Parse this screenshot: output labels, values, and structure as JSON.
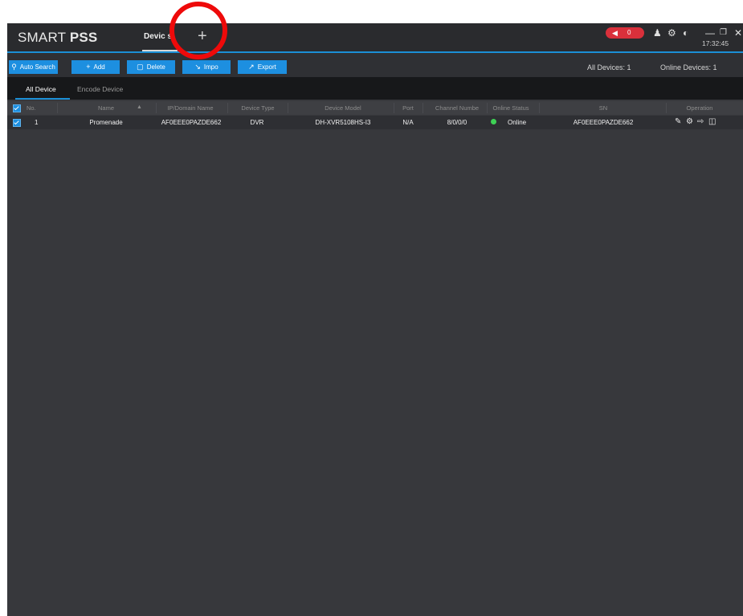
{
  "app": {
    "brand_regular": "SMART ",
    "brand_bold": "PSS",
    "clock": "17:32:45"
  },
  "tabs": {
    "devices_label": "Devic s",
    "add_glyph": "+"
  },
  "alarm": {
    "count": "0"
  },
  "toolbar": {
    "auto_search": "Auto Search",
    "add": "Add",
    "delete": "Delete",
    "import": "Impo",
    "export": "Export",
    "all_devices": "All Devices:  1",
    "online_devices": "Online Devices:  1"
  },
  "subtabs": {
    "all_device": "All Device",
    "encode_device": "Encode Device"
  },
  "table": {
    "headers": {
      "no": "No.",
      "name": "Name",
      "sort_arrow": "▲",
      "ip": "IP/Domain Name",
      "type": "Device Type",
      "model": "Device Model",
      "port": "Port",
      "channel": "Channel Numbe",
      "status": "Online Status",
      "sn": "SN",
      "operation": "Operation"
    },
    "rows": [
      {
        "no": "1",
        "name": "Promenade",
        "ip": "AF0EEE0PAZDE662",
        "type": "DVR",
        "model": "DH-XVR5108HS-I3",
        "port": "N/A",
        "channel": "8/0/0/0",
        "status": "Online",
        "sn": "AF0EEE0PAZDE662"
      }
    ]
  },
  "icons": {
    "speaker": "speaker-icon",
    "user": "user-icon",
    "settings": "gear-icon",
    "performance": "gauge-icon",
    "minimize": "minimize-icon",
    "restore": "restore-icon",
    "close": "close-icon",
    "edit": "pencil-icon",
    "config": "gear-icon",
    "logout": "logout-icon",
    "delete": "trash-icon"
  },
  "colors": {
    "accent": "#1d8fe0",
    "alarm": "#d9303b",
    "online": "#3ed155",
    "highlight_circle": "#ee0a0a"
  }
}
